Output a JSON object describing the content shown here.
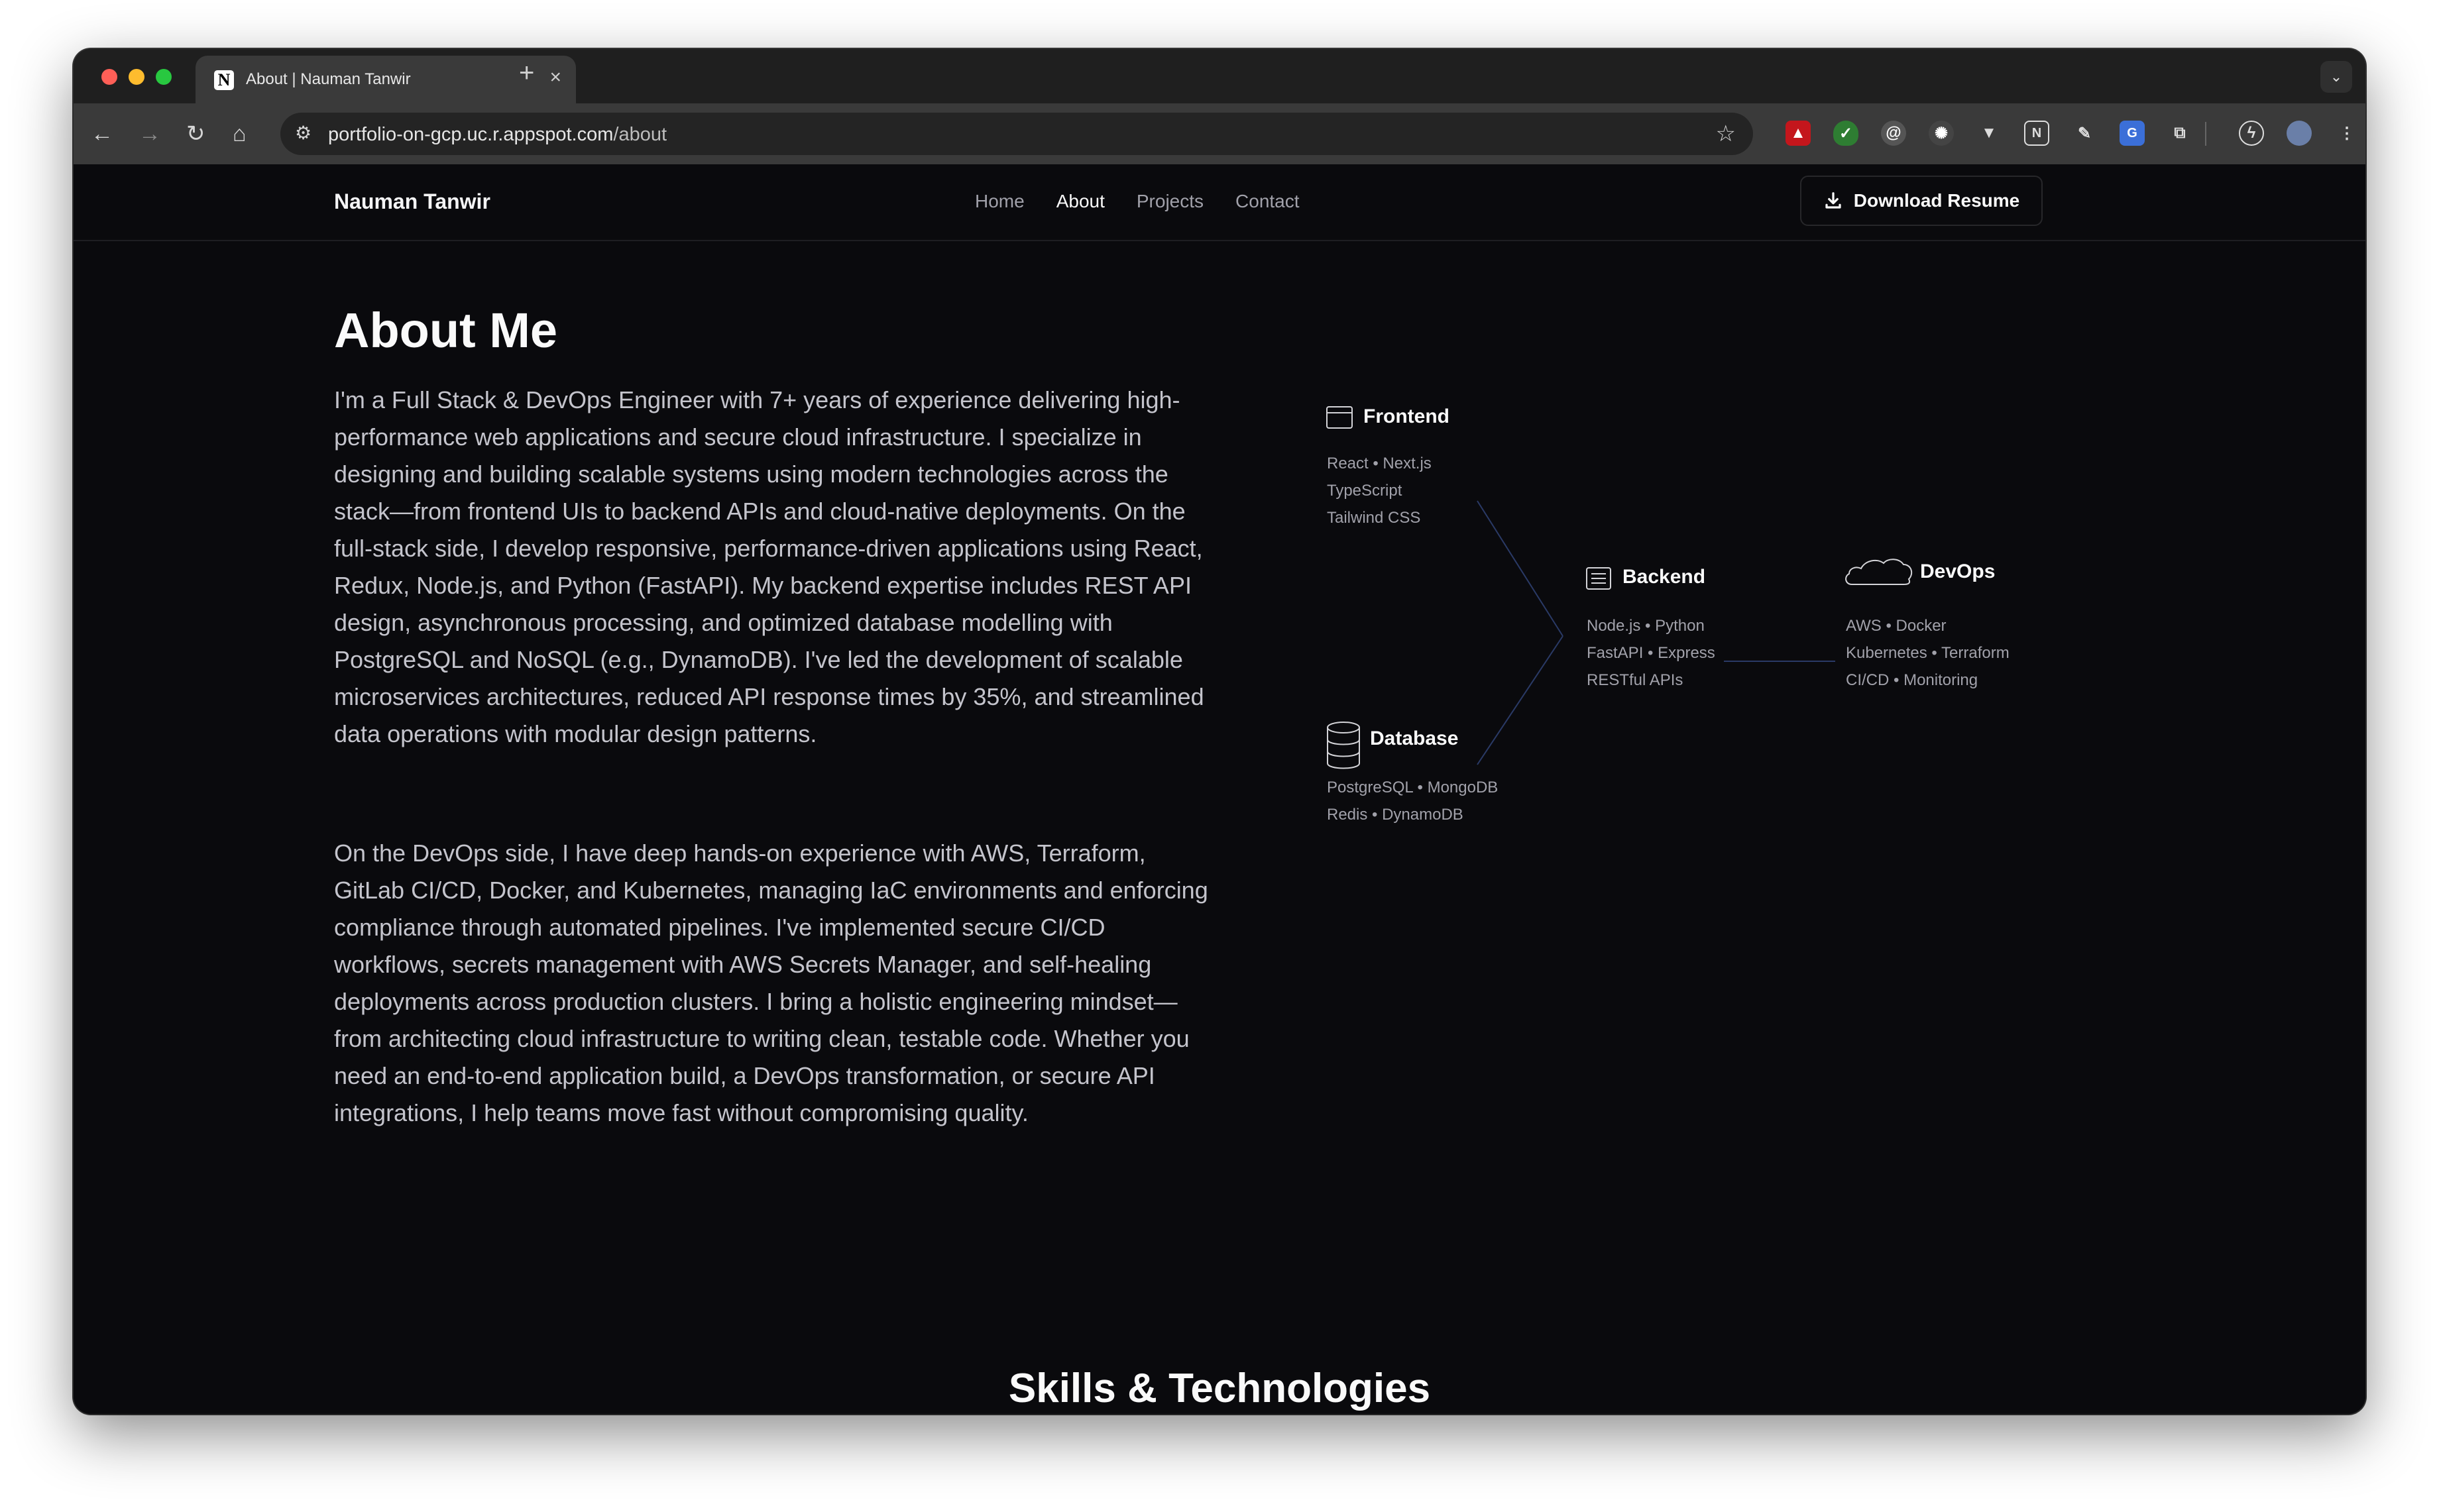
{
  "browser": {
    "tab_title": "About | Nauman Tanwir",
    "tab_favicon": "N",
    "url_host": "portfolio-on-gcp.uc.r.appspot.com",
    "url_path": "/about"
  },
  "nav": {
    "brand": "Nauman Tanwir",
    "links": [
      "Home",
      "About",
      "Projects",
      "Contact"
    ],
    "active": "About",
    "download_label": "Download Resume"
  },
  "about": {
    "title": "About Me",
    "paragraph1": "I'm a Full Stack & DevOps Engineer with 7+ years of experience delivering high-performance web applications and secure cloud infrastructure. I specialize in designing and building scalable systems using modern technologies across the stack—from frontend UIs to backend APIs and cloud-native deployments. On the full-stack side, I develop responsive, performance-driven applications using React, Redux, Node.js, and Python (FastAPI). My backend expertise includes REST API design, asynchronous processing, and optimized database modelling with PostgreSQL and NoSQL (e.g., DynamoDB). I've led the development of scalable microservices architectures, reduced API response times by 35%, and streamlined data operations with modular design patterns.",
    "paragraph2": "On the DevOps side, I have deep hands-on experience with AWS, Terraform, GitLab CI/CD, Docker, and Kubernetes, managing IaC environments and enforcing compliance through automated pipelines. I've implemented secure CI/CD workflows, secrets management with AWS Secrets Manager, and self-healing deployments across production clusters. I bring a holistic engineering mindset—from architecting cloud infrastructure to writing clean, testable code. Whether you need an end-to-end application build, a DevOps transformation, or secure API integrations, I help teams move fast without compromising quality."
  },
  "diagram": {
    "frontend": {
      "title": "Frontend",
      "lines": [
        "React • Next.js",
        "TypeScript",
        "Tailwind CSS"
      ]
    },
    "backend": {
      "title": "Backend",
      "lines": [
        "Node.js • Python",
        "FastAPI • Express",
        "RESTful APIs"
      ]
    },
    "devops": {
      "title": "DevOps",
      "lines": [
        "AWS • Docker",
        "Kubernetes • Terraform",
        "CI/CD • Monitoring"
      ]
    },
    "database": {
      "title": "Database",
      "lines": [
        "PostgreSQL • MongoDB",
        "Redis • DynamoDB"
      ]
    },
    "line_color": "#2a3a66"
  },
  "skills": {
    "title": "Skills & Technologies"
  }
}
